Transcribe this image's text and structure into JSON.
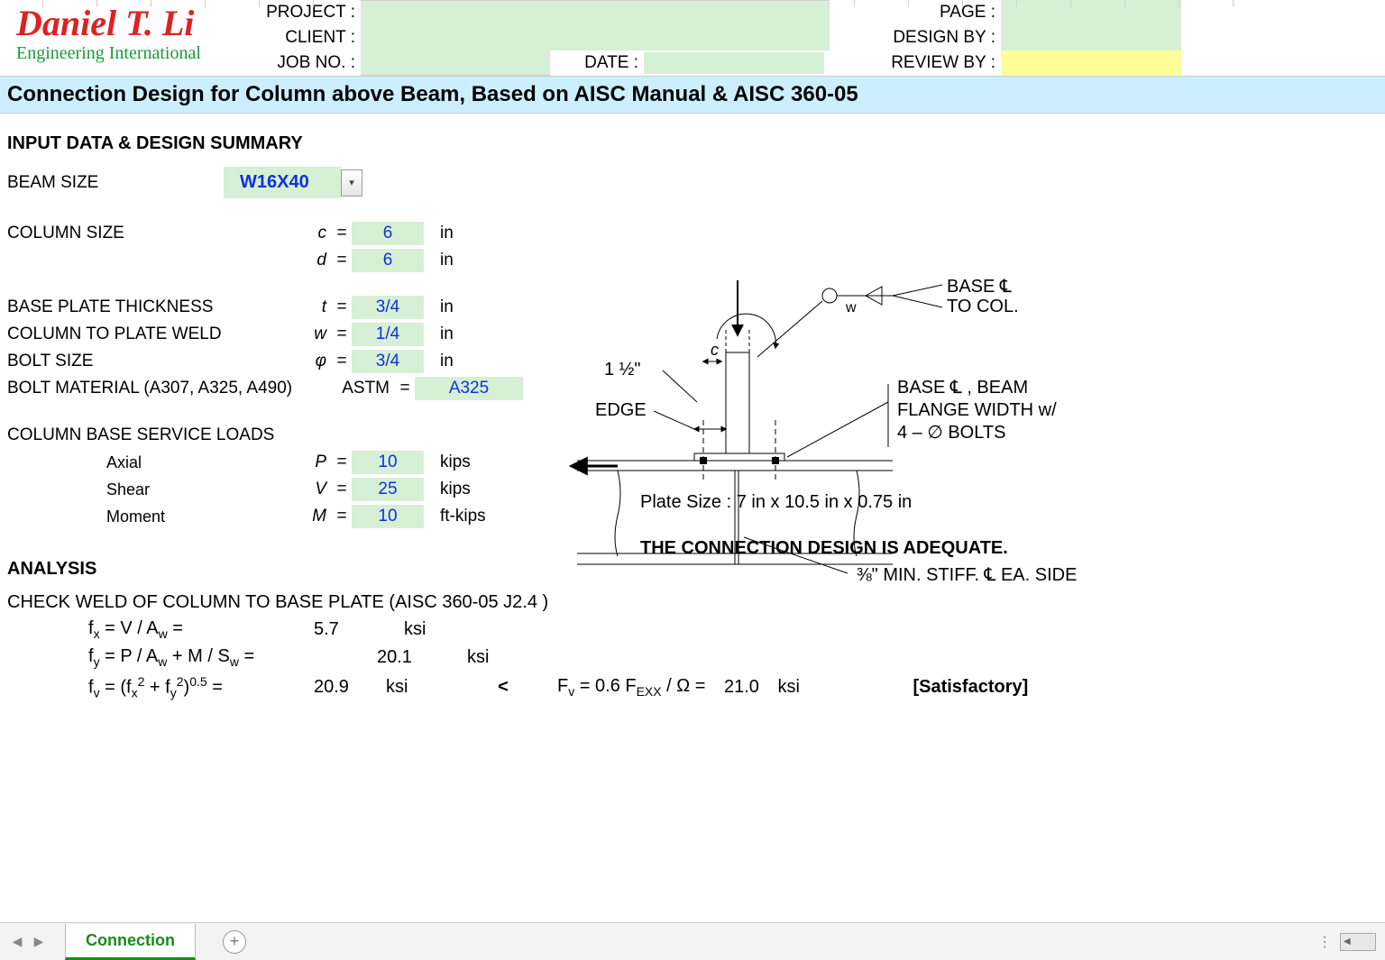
{
  "logo": {
    "name": "Daniel T. Li",
    "sub": "Engineering International"
  },
  "header": {
    "project_lbl": "PROJECT :",
    "client_lbl": "CLIENT :",
    "jobno_lbl": "JOB NO. :",
    "date_lbl": "DATE :",
    "page_lbl": "PAGE :",
    "design_by_lbl": "DESIGN BY :",
    "review_by_lbl": "REVIEW BY :"
  },
  "title": "Connection Design for Column above Beam, Based on AISC Manual & AISC 360-05",
  "sections": {
    "input_head": "INPUT DATA & DESIGN SUMMARY",
    "analysis_head": "ANALYSIS"
  },
  "inputs": {
    "beam_size_lbl": "BEAM SIZE",
    "beam_size_val": "W16X40",
    "column_size_lbl": "COLUMN SIZE",
    "c_sym": "c",
    "c_val": "6",
    "c_unit": "in",
    "d_sym": "d",
    "d_val": "6",
    "d_unit": "in",
    "base_plate_lbl": "BASE PLATE THICKNESS",
    "t_sym": "t",
    "t_val": "3/4",
    "t_unit": "in",
    "weld_lbl": "COLUMN TO PLATE WELD",
    "w_sym": "w",
    "w_val": "1/4",
    "w_unit": "in",
    "bolt_size_lbl": "BOLT SIZE",
    "phi_sym": "φ",
    "phi_val": "3/4",
    "phi_unit": "in",
    "bolt_mat_lbl": "BOLT MATERIAL (A307, A325, A490)",
    "astm_sym": "ASTM",
    "astm_val": "A325",
    "service_loads_lbl": "COLUMN BASE SERVICE LOADS",
    "axial_lbl": "Axial",
    "P_sym": "P",
    "P_val": "10",
    "P_unit": "kips",
    "shear_lbl": "Shear",
    "V_sym": "V",
    "V_val": "25",
    "V_unit": "kips",
    "moment_lbl": "Moment",
    "M_sym": "M",
    "M_val": "10",
    "M_unit": "ft-kips"
  },
  "diagram_labels": {
    "top_dim": "1 ½\"",
    "c": "c",
    "edge": "EDGE",
    "w": "w",
    "base_to_col": "BASE ℄\nTO COL.",
    "base_beam": "BASE ℄ , BEAM\nFLANGE WIDTH w/\n4 – ∅ BOLTS",
    "stiff": "⅜\" MIN. STIFF. ℄ EA. SIDE"
  },
  "results": {
    "plate_size": "Plate Size : 7 in  x 10.5 in  x 0.75 in",
    "adequate": "THE CONNECTION DESIGN IS ADEQUATE."
  },
  "analysis": {
    "check_weld": "CHECK WELD OF COLUMN TO BASE PLATE (AISC 360-05 J2.4 )",
    "fx_formula": "f",
    "fx_eq": " = V / A",
    "fx_val": "5.7",
    "fx_unit": "ksi",
    "fy_eq1": " = P / A",
    "fy_eq2": " + M / S",
    "fy_val": "20.1",
    "fy_unit": "ksi",
    "fv_val": "20.9",
    "fv_unit": "ksi",
    "lt": "<",
    "Fv_eq": " = 0.6 F",
    "Fv_eq2": " / Ω = ",
    "Fv_val": "21.0",
    "Fv_unit": "ksi",
    "satisfactory": "[Satisfactory]"
  },
  "footer": {
    "tab": "Connection"
  }
}
